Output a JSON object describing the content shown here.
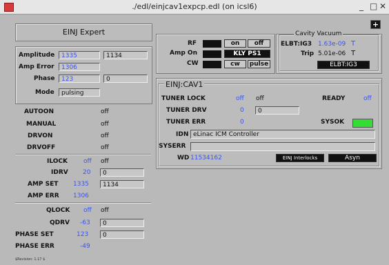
{
  "window": {
    "title": "./edl/einjcav1expcp.edl (on icsl6)",
    "controls": [
      "_",
      "□",
      "✕"
    ]
  },
  "expert": {
    "title": "EINJ Expert"
  },
  "left": {
    "amplitude_label": "Amplitude",
    "amplitude_val": "1335",
    "amplitude_set": "1134",
    "amp_error_label": "Amp Error",
    "amp_error_val": "1306",
    "phase_label": "Phase",
    "phase_val": "123",
    "phase_set": "0",
    "mode_label": "Mode",
    "mode_val": "pulsing",
    "autoon_label": "AUTOON",
    "autoon_val": "off",
    "manual_label": "MANUAL",
    "manual_val": "off",
    "drvon_label": "DRVON",
    "drvon_val": "off",
    "drvoff_label": "DRVOFF",
    "drvoff_val": "off",
    "ilock_label": "ILOCK",
    "ilock_val": "off",
    "ilock_state": "off",
    "idrv_label": "IDRV",
    "idrv_val": "20",
    "idrv_set": "0",
    "ampset_label": "AMP SET",
    "ampset_val": "1335",
    "ampset_set": "1134",
    "amperr_label": "AMP ERR",
    "amperr_val": "1306",
    "qlock_label": "QLOCK",
    "qlock_val": "off",
    "qlock_state": "off",
    "qdrv_label": "QDRV",
    "qdrv_val": "-63",
    "qdrv_set": "0",
    "phaseset_label": "PHASE SET",
    "phaseset_val": "123",
    "phaseset_set": "0",
    "phaseerr_label": "PHASE ERR",
    "phaseerr_val": "-49",
    "revision": "$Revision: 1.17 $"
  },
  "rfbox": {
    "rf_label": "RF",
    "rf_on": "on",
    "rf_off": "off",
    "ampon_label": "Amp On",
    "ampon_btn": "KLY PS1",
    "cw_label": "CW",
    "cw_btn": "cw",
    "pulse_btn": "pulse"
  },
  "vacuum": {
    "title": "Cavity Vacuum",
    "elbt_label": "ELBT:IG3",
    "elbt_val": "1.63e-09",
    "elbt_unit": "T",
    "trip_label": "Trip",
    "trip_val": "5.01e-06",
    "trip_unit": "T",
    "elbt_btn": "ELBT:IG3",
    "plus": "+"
  },
  "cav": {
    "title": "EINJ:CAV1",
    "tunerlock_label": "TUNER LOCK",
    "tunerlock_val": "off",
    "tunerlock_state": "off",
    "tunerdrv_label": "TUNER DRV",
    "tunerdrv_val": "0",
    "tunerdrv_set": "0",
    "tunererr_label": "TUNER ERR",
    "tunererr_val": "0",
    "ready_label": "READY",
    "ready_val": "off",
    "sysok_label": "SYSOK",
    "idn_label": "IDN",
    "idn_val": "eLinac ICM Controller",
    "syserr_label": "SYSERR",
    "syserr_val": "",
    "wd_label": "WD",
    "wd_val": "11534162",
    "interlocks_btn": "EINJ Interlocks",
    "asyn_btn": "Asyn"
  },
  "colors": {
    "accent_blue": "#3b53f0",
    "ok_green": "#33dd33",
    "bg": "#b9b9b9"
  }
}
